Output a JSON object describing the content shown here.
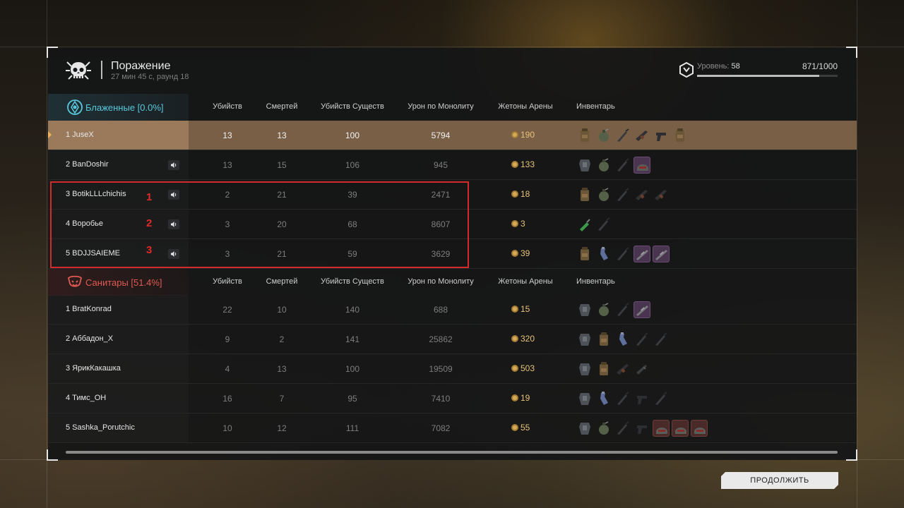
{
  "header": {
    "title": "Поражение",
    "subtitle": "27 мин 45 с, раунд 18",
    "level_label": "Уровень:",
    "level_value": "58",
    "xp_text": "871/1000",
    "xp_progress": 0.871
  },
  "columns": [
    "Убийств",
    "Смертей",
    "Убийств Существ",
    "Урон по Монолиту",
    "Жетоны Арены",
    "Инвентарь"
  ],
  "teams": [
    {
      "name": "Блаженные [0.0%]",
      "color": "#58c8dc",
      "players": [
        {
          "name": "1 JuseX",
          "kills": "13",
          "deaths": "13",
          "creature_kills": "100",
          "monolith_damage": "5794",
          "tokens": "190",
          "highlighted": true,
          "mic": false,
          "items": [
            "backpack-icon",
            "grenade-icon",
            "knife-icon",
            "rifle-icon",
            "pistol-icon",
            "backpack-icon"
          ]
        },
        {
          "name": "2 BanDoshir",
          "kills": "13",
          "deaths": "15",
          "creature_kills": "106",
          "monolith_damage": "945",
          "tokens": "133",
          "mic": true,
          "items": [
            "armor-icon",
            "grenade-icon",
            "knife-icon",
            "helmet-icon"
          ]
        },
        {
          "name": "3 BotikLLLchichis",
          "kills": "2",
          "deaths": "21",
          "creature_kills": "39",
          "monolith_damage": "2471",
          "tokens": "18",
          "mic": true,
          "items": [
            "backpack-icon",
            "grenade-icon",
            "knife-icon",
            "rifle-icon",
            "rifle-icon"
          ]
        },
        {
          "name": "4 Воробье",
          "kills": "3",
          "deaths": "20",
          "creature_kills": "68",
          "monolith_damage": "8607",
          "tokens": "3",
          "mic": true,
          "items": [
            "syringe-icon",
            "knife-icon"
          ]
        },
        {
          "name": "5 BDJJSAIEME",
          "kills": "3",
          "deaths": "21",
          "creature_kills": "59",
          "monolith_damage": "3629",
          "tokens": "39",
          "mic": true,
          "items": [
            "backpack-icon",
            "flask-icon",
            "knife-icon",
            "sniper-icon",
            "sniper-icon"
          ]
        }
      ]
    },
    {
      "name": "Санитары [51.4%]",
      "color": "#e05a52",
      "players": [
        {
          "name": "1 BratKonrad",
          "kills": "22",
          "deaths": "10",
          "creature_kills": "140",
          "monolith_damage": "688",
          "tokens": "15",
          "items": [
            "armor-icon",
            "grenade-icon",
            "knife-icon",
            "sniper-icon"
          ]
        },
        {
          "name": "2 Аббадон_X",
          "kills": "9",
          "deaths": "2",
          "creature_kills": "141",
          "monolith_damage": "25862",
          "tokens": "320",
          "items": [
            "armor-icon",
            "backpack-icon",
            "flask-icon",
            "knife-icon",
            "knife-icon"
          ]
        },
        {
          "name": "3 ЯрикКакашка",
          "kills": "4",
          "deaths": "13",
          "creature_kills": "100",
          "monolith_damage": "19509",
          "tokens": "503",
          "items": [
            "armor-icon",
            "backpack-icon",
            "rifle-icon",
            "shotgun-icon"
          ]
        },
        {
          "name": "4 Тимс_ОН",
          "kills": "16",
          "deaths": "7",
          "creature_kills": "95",
          "monolith_damage": "7410",
          "tokens": "19",
          "items": [
            "armor-icon",
            "flask-icon",
            "knife-icon",
            "pistol-icon",
            "knife-icon"
          ]
        },
        {
          "name": "5 Sashka_Porutchic",
          "kills": "10",
          "deaths": "12",
          "creature_kills": "111",
          "monolith_damage": "7082",
          "tokens": "55",
          "items": [
            "armor-icon",
            "grenade-icon",
            "knife-icon",
            "pistol-icon",
            "helmet-icon",
            "helmet-icon",
            "helmet-icon"
          ]
        }
      ]
    }
  ],
  "annotations": [
    "1",
    "2",
    "3"
  ],
  "footer": {
    "continue_label": "ПРОДОЛЖИТЬ"
  }
}
